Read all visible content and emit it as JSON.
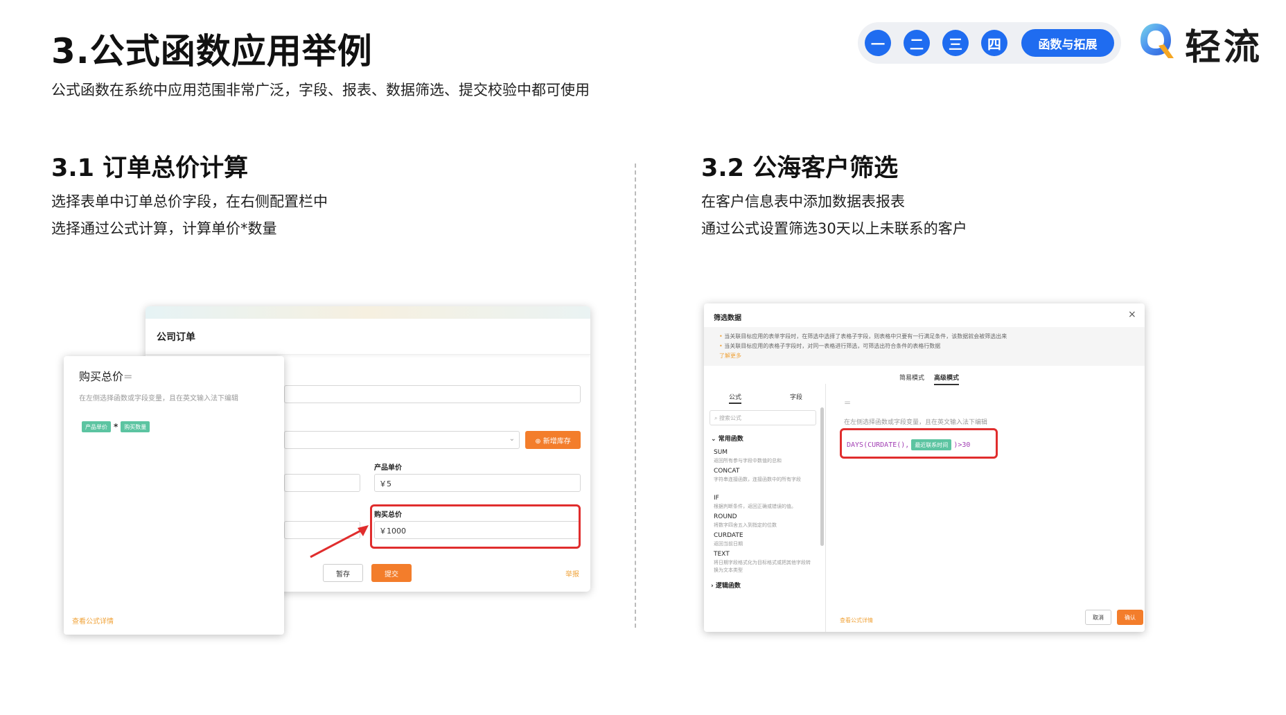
{
  "header": {
    "title": "3.公式函数应用举例",
    "subtitle": "公式函数在系统中应用范围非常广泛，字段、报表、数据筛选、提交校验中都可使用",
    "nav": {
      "items": [
        "一",
        "二",
        "三",
        "四"
      ],
      "active": "函数与拓展"
    },
    "logo_text": "轻流"
  },
  "section1": {
    "title": "3.1 订单总价计算",
    "desc_line1": "选择表单中订单总价字段，在右侧配置栏中",
    "desc_line2": "选择通过公式计算，计算单价*数量",
    "order_form": {
      "title": "公司订单",
      "stock_button": "⊕ 新增库存",
      "unit_price_label": "产品单价",
      "unit_price_value": "￥5",
      "total_label": "购买总价",
      "total_value": "￥1000",
      "save_button": "暂存",
      "submit_button": "提交",
      "report_link": "举报"
    },
    "formula_editor": {
      "title": "购买总价",
      "eq": "=",
      "hint": "在左侧选择函数或字段变量，且在英文输入法下编辑",
      "tag1": "产品单价",
      "operator": "*",
      "tag2": "购买数量",
      "detail_link": "查看公式详情"
    }
  },
  "section2": {
    "title": "3.2 公海客户筛选",
    "desc_line1": "在客户信息表中添加数据表报表",
    "desc_line2": "通过公式设置筛选30天以上未联系的客户",
    "filter_dialog": {
      "title": "筛选数据",
      "close": "×",
      "note1": "当关联目标应用的表单字段时，在筛选中选择了表格子字段，则表格中只要有一行满足条件，该数据就会被筛选出来",
      "note2": "当关联目标应用的表格子字段时，对同一表格进行筛选，可筛选出符合条件的表格行数据",
      "more_link": "了解更多",
      "tab_simple": "简易模式",
      "tab_advanced": "高级模式",
      "left_tab_formula": "公式",
      "left_tab_field": "字段",
      "search_placeholder": "搜索公式",
      "group_common": "常用函数",
      "functions": [
        {
          "name": "SUM",
          "desc": "返回所有参与字段中数值的总和"
        },
        {
          "name": "CONCAT",
          "desc": "字符串连接函数，连接函数中的所有字段"
        },
        {
          "name": "IF",
          "desc": "根据判断条件，返回正确或错误的值。"
        },
        {
          "name": "ROUND",
          "desc": "将数字四舍五入到指定的位数"
        },
        {
          "name": "CURDATE",
          "desc": "返回当前日期"
        },
        {
          "name": "TEXT",
          "desc": "将日期字段格式化为目标格式或把其他字段转换为文本类型"
        }
      ],
      "group_logic": "逻辑函数",
      "eq": "=",
      "hint": "在左侧选择函数或字段变量，且在英文输入法下编辑",
      "code_prefix": "DAYS(CURDATE(),",
      "code_tag": "最近联系时间",
      "code_suffix": ")>30",
      "detail_link": "查看公式详情",
      "cancel_button": "取消",
      "confirm_button": "确认"
    }
  }
}
